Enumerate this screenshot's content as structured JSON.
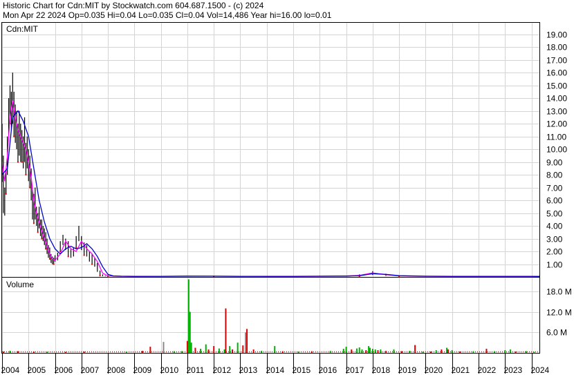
{
  "header": {
    "line1": "Historic Chart for Cdn:MIT by Stockwatch.com 604.687.1500 - (c) 2024",
    "line2": "Mon Apr 22 2024   Op=0.035   Hi=0.04   Lo=0.035   Cl=0.04   Vol=14,486   Year hi=16.00   lo=0.01"
  },
  "price_panel_label": "Cdn:MIT",
  "volume_panel_label": "Volume",
  "colors": {
    "price_bars": "#000000",
    "up_marker": "#e00000",
    "ma_short": "#ff00ff",
    "ma_long": "#0000cc",
    "volume_up": "#00b000",
    "volume_down": "#e00000",
    "volume_neutral": "#888888",
    "grid": "#d4d4d4"
  },
  "chart_data": [
    {
      "type": "line",
      "panel": "price",
      "ylabel_position": "right",
      "y_ticks": [
        "1.00",
        "2.00",
        "3.00",
        "4.00",
        "5.00",
        "6.00",
        "7.00",
        "8.00",
        "9.00",
        "10.00",
        "11.00",
        "12.00",
        "13.00",
        "14.00",
        "15.00",
        "16.00",
        "17.00",
        "18.00",
        "19.00"
      ],
      "ylim": [
        0,
        19.9
      ],
      "x_ticks": [
        "2004",
        "2005",
        "2006",
        "2007",
        "2008",
        "2009",
        "2010",
        "2011",
        "2012",
        "2013",
        "2014",
        "2015",
        "2016",
        "2017",
        "2018",
        "2019",
        "2020",
        "2021",
        "2022",
        "2023",
        "2024"
      ],
      "xlim": [
        2004.0,
        2024.3
      ],
      "grid": true,
      "series": [
        {
          "role": "price_high_low",
          "x": [
            2004.0,
            2004.05,
            2004.1,
            2004.15,
            2004.2,
            2004.25,
            2004.3,
            2004.35,
            2004.4,
            2004.45,
            2004.5,
            2004.55,
            2004.6,
            2004.65,
            2004.7,
            2004.75,
            2004.8,
            2004.85,
            2004.9,
            2004.95,
            2005.0,
            2005.05,
            2005.1,
            2005.15,
            2005.2,
            2005.25,
            2005.3,
            2005.35,
            2005.4,
            2005.45,
            2005.5,
            2005.55,
            2005.6,
            2005.65,
            2005.7,
            2005.75,
            2005.8,
            2005.85,
            2005.9,
            2005.95,
            2006.0,
            2006.1,
            2006.2,
            2006.3,
            2006.4,
            2006.5,
            2006.6,
            2006.7,
            2006.8,
            2006.9,
            2007.0,
            2007.1,
            2007.2,
            2007.3,
            2007.4,
            2007.5,
            2007.6,
            2007.7,
            2007.8,
            2007.9,
            2008.0,
            2008.2,
            2008.5,
            2009.0,
            2010.0,
            2011.0,
            2012.0,
            2013.0,
            2014.0,
            2015.0,
            2016.0,
            2017.0,
            2017.5,
            2018.0,
            2018.5,
            2019.0,
            2020.0,
            2021.0,
            2022.0,
            2023.0,
            2024.0,
            2024.3
          ],
          "high": [
            12.0,
            9.5,
            7.0,
            8.5,
            11.0,
            14.0,
            15.0,
            14.5,
            16.0,
            14.5,
            13.5,
            13.0,
            12.0,
            13.0,
            12.0,
            11.5,
            11.0,
            12.5,
            10.5,
            11.0,
            10.0,
            9.5,
            8.5,
            7.0,
            6.5,
            7.0,
            5.5,
            5.0,
            5.5,
            4.5,
            4.5,
            4.0,
            3.8,
            3.5,
            3.0,
            2.5,
            2.3,
            1.8,
            1.6,
            1.5,
            1.7,
            1.9,
            2.8,
            3.3,
            3.0,
            2.8,
            2.2,
            2.3,
            3.2,
            4.0,
            3.2,
            2.7,
            2.5,
            2.0,
            1.8,
            1.5,
            1.1,
            0.5,
            0.2,
            0.1,
            0.15,
            0.08,
            0.06,
            0.05,
            0.08,
            0.1,
            0.09,
            0.07,
            0.06,
            0.06,
            0.09,
            0.1,
            0.2,
            0.45,
            0.25,
            0.12,
            0.08,
            0.06,
            0.05,
            0.05,
            0.05,
            0.04
          ],
          "low": [
            7.5,
            5.0,
            4.8,
            6.5,
            8.0,
            11.0,
            12.0,
            11.5,
            12.0,
            11.0,
            10.5,
            10.0,
            9.0,
            9.5,
            9.0,
            9.0,
            8.5,
            9.0,
            8.0,
            8.5,
            7.5,
            7.0,
            6.0,
            4.5,
            4.2,
            4.5,
            4.0,
            3.5,
            3.8,
            3.2,
            3.0,
            2.8,
            2.5,
            2.2,
            1.8,
            1.5,
            1.4,
            1.1,
            1.0,
            1.0,
            1.2,
            1.3,
            2.0,
            2.5,
            2.1,
            1.6,
            1.5,
            1.6,
            2.3,
            2.8,
            2.1,
            1.7,
            1.6,
            1.2,
            1.0,
            0.8,
            0.4,
            0.1,
            0.05,
            0.05,
            0.05,
            0.03,
            0.02,
            0.02,
            0.03,
            0.04,
            0.03,
            0.02,
            0.02,
            0.02,
            0.03,
            0.04,
            0.05,
            0.15,
            0.08,
            0.04,
            0.02,
            0.02,
            0.02,
            0.02,
            0.02,
            0.035
          ]
        },
        {
          "name": "",
          "role": "moving_average_short",
          "x": [
            2004.0,
            2004.1,
            2004.2,
            2004.3,
            2004.4,
            2004.5,
            2004.6,
            2004.7,
            2004.8,
            2004.9,
            2005.0,
            2005.1,
            2005.2,
            2005.3,
            2005.4,
            2005.5,
            2005.6,
            2005.7,
            2005.8,
            2005.9,
            2006.0,
            2006.2,
            2006.4,
            2006.6,
            2006.8,
            2007.0,
            2007.2,
            2007.4,
            2007.6,
            2007.8,
            2008.0,
            2008.5,
            2009.0,
            2010.0,
            2011.0,
            2012.0,
            2013.0,
            2014.0,
            2015.0,
            2016.0,
            2017.0,
            2017.5,
            2018.0,
            2018.5,
            2019.0,
            2020.0,
            2021.0,
            2022.0,
            2023.0,
            2024.0,
            2024.3
          ],
          "y": [
            9.0,
            7.5,
            9.5,
            12.5,
            13.8,
            12.5,
            11.5,
            11.0,
            10.5,
            10.0,
            9.0,
            7.8,
            6.0,
            5.0,
            4.3,
            3.6,
            3.0,
            2.4,
            1.8,
            1.4,
            1.3,
            1.8,
            2.8,
            2.2,
            2.0,
            2.8,
            2.2,
            1.8,
            1.2,
            0.3,
            0.08,
            0.05,
            0.04,
            0.05,
            0.07,
            0.06,
            0.05,
            0.04,
            0.04,
            0.05,
            0.07,
            0.12,
            0.32,
            0.18,
            0.08,
            0.05,
            0.04,
            0.04,
            0.04,
            0.04,
            0.04
          ]
        },
        {
          "name": "",
          "role": "moving_average_long",
          "x": [
            2004.0,
            2004.2,
            2004.4,
            2004.6,
            2004.8,
            2005.0,
            2005.2,
            2005.4,
            2005.6,
            2005.8,
            2006.0,
            2006.2,
            2006.4,
            2006.6,
            2006.8,
            2007.0,
            2007.2,
            2007.4,
            2007.6,
            2007.8,
            2008.0,
            2008.2,
            2008.5,
            2009.0,
            2010.0,
            2011.0,
            2012.0,
            2013.0,
            2014.0,
            2015.0,
            2016.0,
            2017.0,
            2017.5,
            2018.0,
            2018.5,
            2019.0,
            2020.0,
            2021.0,
            2022.0,
            2023.0,
            2024.0,
            2024.3
          ],
          "y": [
            8.0,
            8.5,
            12.5,
            13.0,
            12.2,
            11.0,
            8.5,
            6.0,
            4.3,
            3.0,
            2.2,
            1.8,
            2.2,
            2.4,
            2.2,
            2.3,
            2.6,
            2.2,
            1.6,
            0.8,
            0.2,
            0.08,
            0.06,
            0.05,
            0.05,
            0.06,
            0.06,
            0.05,
            0.05,
            0.05,
            0.06,
            0.07,
            0.1,
            0.25,
            0.2,
            0.1,
            0.06,
            0.05,
            0.05,
            0.05,
            0.05,
            0.04
          ]
        }
      ]
    },
    {
      "type": "bar",
      "panel": "volume",
      "y_ticks": [
        "6.0 M",
        "12.0 M",
        "18.0 M"
      ],
      "ylim": [
        0,
        22
      ],
      "grid": true,
      "bars": [
        {
          "x": 2004.05,
          "value": 0.4,
          "dir": "down"
        },
        {
          "x": 2004.3,
          "value": 0.6,
          "dir": "up"
        },
        {
          "x": 2004.6,
          "value": 0.5,
          "dir": "down"
        },
        {
          "x": 2005.2,
          "value": 0.4,
          "dir": "down"
        },
        {
          "x": 2005.7,
          "value": 0.3,
          "dir": "up"
        },
        {
          "x": 2006.4,
          "value": 0.3,
          "dir": "down"
        },
        {
          "x": 2007.1,
          "value": 0.4,
          "dir": "down"
        },
        {
          "x": 2008.7,
          "value": 0.3,
          "dir": "up"
        },
        {
          "x": 2009.3,
          "value": 0.6,
          "dir": "down"
        },
        {
          "x": 2009.6,
          "value": 1.8,
          "dir": "down"
        },
        {
          "x": 2010.1,
          "value": 0.9,
          "dir": "down"
        },
        {
          "x": 2010.5,
          "value": 0.5,
          "dir": "up"
        },
        {
          "x": 2010.8,
          "value": 0.5,
          "dir": "up"
        },
        {
          "x": 2010.1,
          "value": 3.2,
          "dir": "neutral"
        },
        {
          "x": 2011.0,
          "value": 3.5,
          "dir": "down"
        },
        {
          "x": 2011.05,
          "value": 21.5,
          "dir": "up"
        },
        {
          "x": 2011.1,
          "value": 12.0,
          "dir": "up"
        },
        {
          "x": 2011.15,
          "value": 3.0,
          "dir": "up"
        },
        {
          "x": 2011.3,
          "value": 1.5,
          "dir": "down"
        },
        {
          "x": 2011.5,
          "value": 1.2,
          "dir": "up"
        },
        {
          "x": 2011.7,
          "value": 2.5,
          "dir": "up"
        },
        {
          "x": 2011.8,
          "value": 1.0,
          "dir": "down"
        },
        {
          "x": 2012.0,
          "value": 2.0,
          "dir": "down"
        },
        {
          "x": 2012.2,
          "value": 1.3,
          "dir": "up"
        },
        {
          "x": 2012.4,
          "value": 1.0,
          "dir": "up"
        },
        {
          "x": 2012.45,
          "value": 13.0,
          "dir": "down"
        },
        {
          "x": 2012.6,
          "value": 2.0,
          "dir": "up"
        },
        {
          "x": 2012.7,
          "value": 1.0,
          "dir": "down"
        },
        {
          "x": 2012.9,
          "value": 3.0,
          "dir": "up"
        },
        {
          "x": 2013.1,
          "value": 2.2,
          "dir": "down"
        },
        {
          "x": 2013.2,
          "value": 6.0,
          "dir": "neutral"
        },
        {
          "x": 2013.25,
          "value": 7.0,
          "dir": "down"
        },
        {
          "x": 2013.5,
          "value": 1.0,
          "dir": "down"
        },
        {
          "x": 2013.8,
          "value": 0.6,
          "dir": "up"
        },
        {
          "x": 2014.3,
          "value": 2.0,
          "dir": "up"
        },
        {
          "x": 2014.6,
          "value": 0.5,
          "dir": "down"
        },
        {
          "x": 2015.2,
          "value": 0.4,
          "dir": "up"
        },
        {
          "x": 2015.7,
          "value": 0.5,
          "dir": "down"
        },
        {
          "x": 2016.4,
          "value": 0.6,
          "dir": "up"
        },
        {
          "x": 2016.9,
          "value": 1.2,
          "dir": "up"
        },
        {
          "x": 2017.0,
          "value": 1.8,
          "dir": "up"
        },
        {
          "x": 2017.2,
          "value": 1.0,
          "dir": "down"
        },
        {
          "x": 2017.4,
          "value": 1.3,
          "dir": "up"
        },
        {
          "x": 2017.5,
          "value": 1.6,
          "dir": "up"
        },
        {
          "x": 2017.6,
          "value": 1.0,
          "dir": "up"
        },
        {
          "x": 2017.75,
          "value": 0.8,
          "dir": "down"
        },
        {
          "x": 2017.85,
          "value": 2.0,
          "dir": "up"
        },
        {
          "x": 2017.9,
          "value": 1.5,
          "dir": "up"
        },
        {
          "x": 2018.0,
          "value": 1.2,
          "dir": "up"
        },
        {
          "x": 2018.1,
          "value": 1.0,
          "dir": "up"
        },
        {
          "x": 2018.2,
          "value": 0.8,
          "dir": "down"
        },
        {
          "x": 2018.3,
          "value": 1.0,
          "dir": "up"
        },
        {
          "x": 2018.5,
          "value": 0.6,
          "dir": "down"
        },
        {
          "x": 2018.8,
          "value": 1.0,
          "dir": "up"
        },
        {
          "x": 2019.1,
          "value": 0.5,
          "dir": "down"
        },
        {
          "x": 2019.4,
          "value": 0.6,
          "dir": "up"
        },
        {
          "x": 2019.6,
          "value": 2.3,
          "dir": "down"
        },
        {
          "x": 2019.9,
          "value": 0.4,
          "dir": "up"
        },
        {
          "x": 2020.2,
          "value": 0.4,
          "dir": "down"
        },
        {
          "x": 2020.4,
          "value": 0.8,
          "dir": "up"
        },
        {
          "x": 2020.6,
          "value": 1.0,
          "dir": "down"
        },
        {
          "x": 2020.8,
          "value": 1.5,
          "dir": "up"
        },
        {
          "x": 2020.85,
          "value": 1.0,
          "dir": "down"
        },
        {
          "x": 2021.0,
          "value": 0.8,
          "dir": "up"
        },
        {
          "x": 2021.3,
          "value": 0.4,
          "dir": "down"
        },
        {
          "x": 2021.8,
          "value": 0.5,
          "dir": "up"
        },
        {
          "x": 2022.3,
          "value": 1.2,
          "dir": "down"
        },
        {
          "x": 2022.6,
          "value": 0.5,
          "dir": "up"
        },
        {
          "x": 2023.0,
          "value": 0.8,
          "dir": "up"
        },
        {
          "x": 2023.2,
          "value": 1.0,
          "dir": "up"
        },
        {
          "x": 2023.4,
          "value": 0.4,
          "dir": "down"
        },
        {
          "x": 2023.8,
          "value": 0.5,
          "dir": "up"
        },
        {
          "x": 2024.1,
          "value": 0.3,
          "dir": "up"
        }
      ]
    }
  ]
}
